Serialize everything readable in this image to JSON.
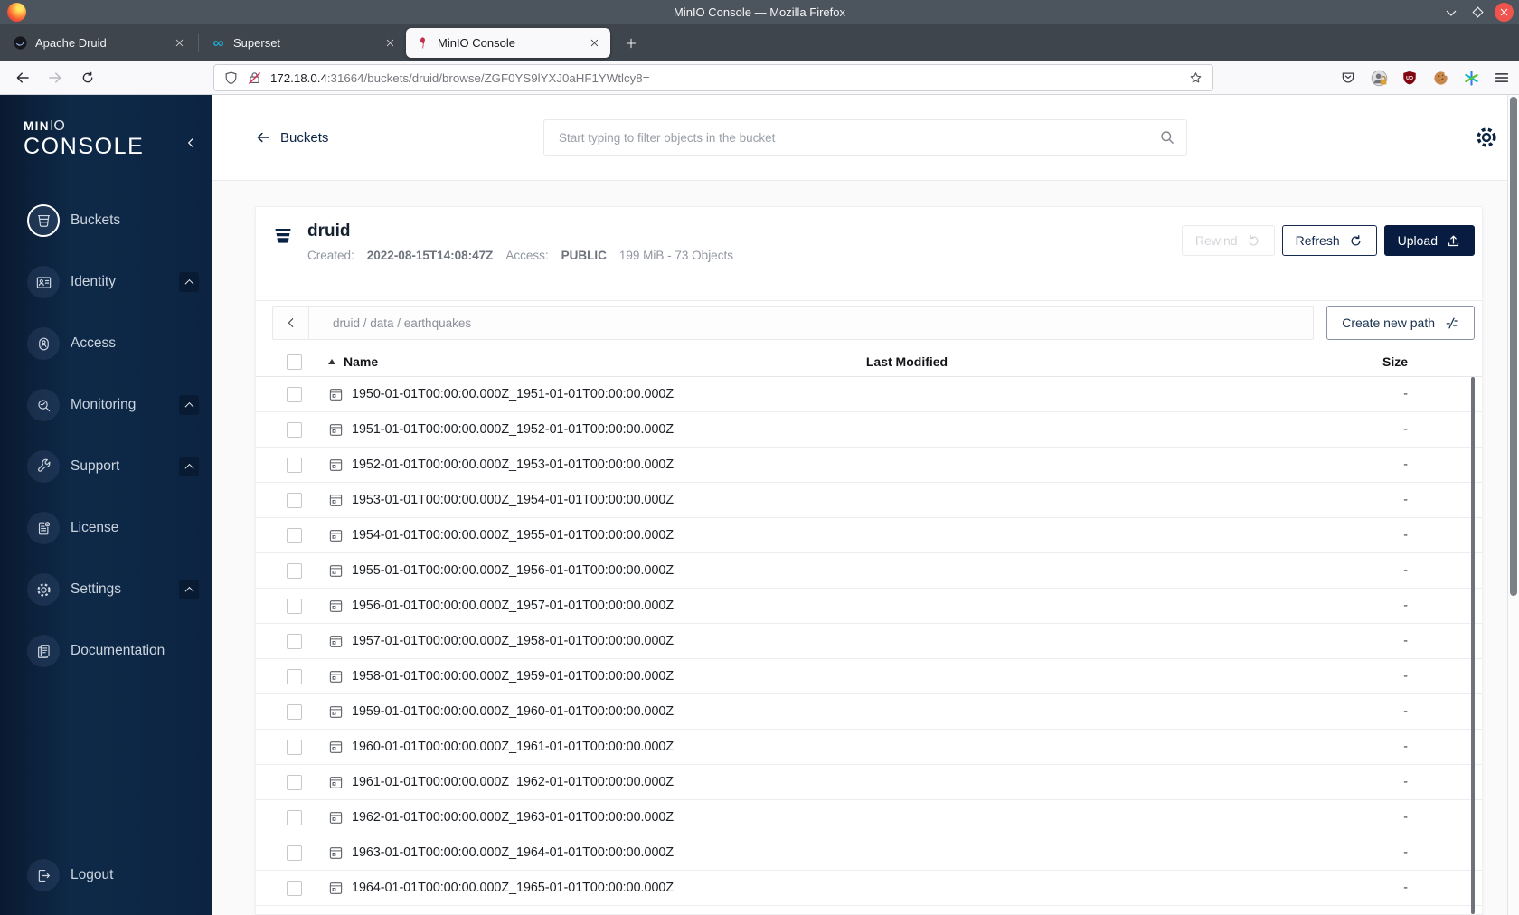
{
  "window": {
    "title": "MinIO Console — Mozilla Firefox"
  },
  "browser": {
    "tabs": [
      {
        "label": "Apache Druid",
        "icon": "druid-favicon",
        "active": false
      },
      {
        "label": "Superset",
        "icon": "superset-favicon",
        "active": false
      },
      {
        "label": "MinIO Console",
        "icon": "minio-favicon",
        "active": true
      }
    ],
    "url_host": "172.18.0.4",
    "url_rest": ":31664/buckets/druid/browse/ZGF0YS9lYXJ0aHF1YWtlcy8="
  },
  "sidebar": {
    "logo_min": "MIN",
    "logo_io": "IO",
    "logo_console": "CONSOLE",
    "items": [
      {
        "label": "Buckets",
        "icon": "bucket-icon",
        "active": true,
        "caret": false
      },
      {
        "label": "Identity",
        "icon": "identity-icon",
        "active": false,
        "caret": true
      },
      {
        "label": "Access",
        "icon": "access-icon",
        "active": false,
        "caret": false
      },
      {
        "label": "Monitoring",
        "icon": "monitoring-icon",
        "active": false,
        "caret": true
      },
      {
        "label": "Support",
        "icon": "support-icon",
        "active": false,
        "caret": true
      },
      {
        "label": "License",
        "icon": "license-icon",
        "active": false,
        "caret": false
      },
      {
        "label": "Settings",
        "icon": "settings-icon",
        "active": false,
        "caret": true
      },
      {
        "label": "Documentation",
        "icon": "documentation-icon",
        "active": false,
        "caret": false
      }
    ],
    "logout": {
      "label": "Logout",
      "icon": "logout-icon"
    }
  },
  "main_header": {
    "back_label": "Buckets",
    "search_placeholder": "Start typing to filter objects in the bucket"
  },
  "bucket": {
    "name": "druid",
    "created_label": "Created:",
    "created_value": "2022-08-15T14:08:47Z",
    "access_label": "Access:",
    "access_value": "PUBLIC",
    "stats": "199 MiB - 73 Objects",
    "rewind_label": "Rewind",
    "refresh_label": "Refresh",
    "upload_label": "Upload"
  },
  "path_bar": {
    "breadcrumb": "druid / data / earthquakes",
    "create_button": "Create new path"
  },
  "object_table": {
    "name_header": "Name",
    "modified_header": "Last Modified",
    "size_header": "Size",
    "rows": [
      {
        "name": "1950-01-01T00:00:00.000Z_1951-01-01T00:00:00.000Z",
        "modified": "",
        "size": "-"
      },
      {
        "name": "1951-01-01T00:00:00.000Z_1952-01-01T00:00:00.000Z",
        "modified": "",
        "size": "-"
      },
      {
        "name": "1952-01-01T00:00:00.000Z_1953-01-01T00:00:00.000Z",
        "modified": "",
        "size": "-"
      },
      {
        "name": "1953-01-01T00:00:00.000Z_1954-01-01T00:00:00.000Z",
        "modified": "",
        "size": "-"
      },
      {
        "name": "1954-01-01T00:00:00.000Z_1955-01-01T00:00:00.000Z",
        "modified": "",
        "size": "-"
      },
      {
        "name": "1955-01-01T00:00:00.000Z_1956-01-01T00:00:00.000Z",
        "modified": "",
        "size": "-"
      },
      {
        "name": "1956-01-01T00:00:00.000Z_1957-01-01T00:00:00.000Z",
        "modified": "",
        "size": "-"
      },
      {
        "name": "1957-01-01T00:00:00.000Z_1958-01-01T00:00:00.000Z",
        "modified": "",
        "size": "-"
      },
      {
        "name": "1958-01-01T00:00:00.000Z_1959-01-01T00:00:00.000Z",
        "modified": "",
        "size": "-"
      },
      {
        "name": "1959-01-01T00:00:00.000Z_1960-01-01T00:00:00.000Z",
        "modified": "",
        "size": "-"
      },
      {
        "name": "1960-01-01T00:00:00.000Z_1961-01-01T00:00:00.000Z",
        "modified": "",
        "size": "-"
      },
      {
        "name": "1961-01-01T00:00:00.000Z_1962-01-01T00:00:00.000Z",
        "modified": "",
        "size": "-"
      },
      {
        "name": "1962-01-01T00:00:00.000Z_1963-01-01T00:00:00.000Z",
        "modified": "",
        "size": "-"
      },
      {
        "name": "1963-01-01T00:00:00.000Z_1964-01-01T00:00:00.000Z",
        "modified": "",
        "size": "-"
      },
      {
        "name": "1964-01-01T00:00:00.000Z_1965-01-01T00:00:00.000Z",
        "modified": "",
        "size": "-"
      }
    ]
  },
  "colors": {
    "accent_navy": "#081C42",
    "link_navy": "#0A2342",
    "close_button_red": "#f0544c",
    "active_tab_bg": "#f9f9fb",
    "sidebar_navy": "#0c2442"
  }
}
